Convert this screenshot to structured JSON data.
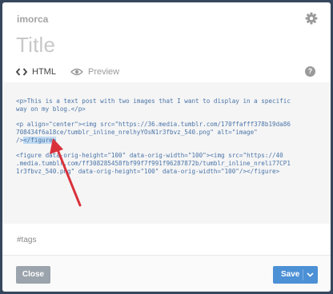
{
  "header": {
    "blog_name": "imorca",
    "title_placeholder": "Title"
  },
  "tabs": [
    {
      "label": "HTML",
      "icon": "code-icon",
      "active": true
    },
    {
      "label": "Preview",
      "icon": "eye-icon",
      "active": false
    }
  ],
  "help_label": "?",
  "editor": {
    "lines": [
      "<p>This is a text post with two images that I want to display in a specific",
      "way on my blog.</p>",
      "<p align=\"center\"><img src=\"https://36.media.tumblr.com/170ffafff378b19da86",
      "708434f6a18ce/tumblr_inline_nrelhyYOsN1r3fbvz_540.png\" alt=\"image\"",
      "/>",
      "</figure>",
      "<figure data-orig-height=\"100\" data-orig-width=\"100\"><img src=\"https://40",
      ".media.tumblr.com/ff308285458fbf99f7f991f96287872b/tumblr_inline_nreli77CP1",
      "1r3fbvz_540.png\" data-orig-height=\"100\" data-orig-width=\"100\"/></figure>"
    ]
  },
  "tags_placeholder": "#tags",
  "footer": {
    "close_label": "Close",
    "save_label": "Save"
  },
  "colors": {
    "background": "#36465d",
    "code": "#4a74a8",
    "highlight": "#bfd9f1",
    "save": "#4c90d5",
    "close": "#9ba3ac",
    "arrow": "#d9313b"
  }
}
